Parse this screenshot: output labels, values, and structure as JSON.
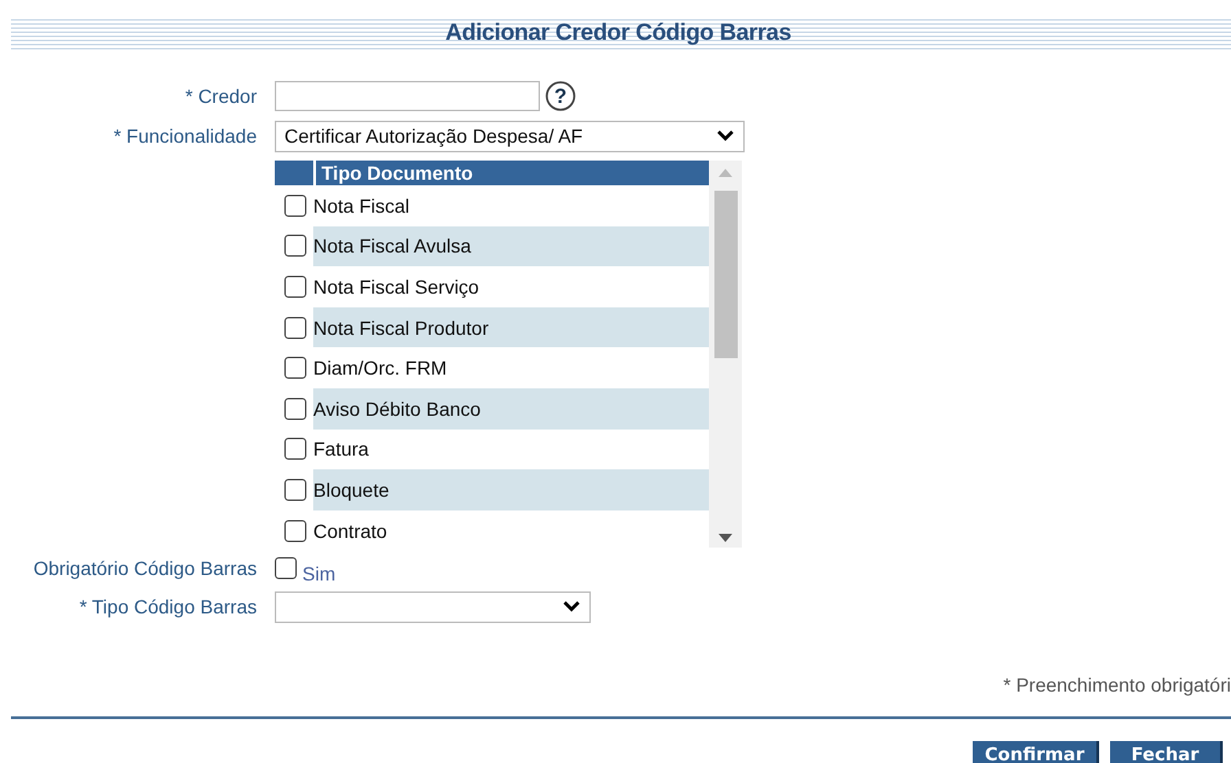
{
  "title": "Adicionar Credor Código Barras",
  "form": {
    "credor": {
      "label": "* Credor",
      "help": "?"
    },
    "funcionalidade": {
      "label": "* Funcionalidade",
      "value": "Certificar Autorização Despesa/ AF"
    },
    "tipo_documento": {
      "header": "Tipo Documento",
      "rows": [
        {
          "label": "Nota Fiscal",
          "checked": false
        },
        {
          "label": "Nota Fiscal Avulsa",
          "checked": false
        },
        {
          "label": "Nota Fiscal Serviço",
          "checked": false
        },
        {
          "label": "Nota Fiscal Produtor",
          "checked": false
        },
        {
          "label": "Diam/Orc. FRM",
          "checked": false
        },
        {
          "label": "Aviso Débito Banco",
          "checked": false
        },
        {
          "label": "Fatura",
          "checked": false
        },
        {
          "label": "Bloquete",
          "checked": false
        },
        {
          "label": "Contrato",
          "checked": false
        }
      ]
    },
    "obrigatorio": {
      "label": "Obrigatório Código Barras",
      "option": "Sim",
      "checked": false
    },
    "tipo_codigo": {
      "label": "* Tipo Código Barras"
    }
  },
  "note": "* Preenchimento obrigatóri",
  "buttons": [
    "Confirmar",
    "Fechar"
  ]
}
